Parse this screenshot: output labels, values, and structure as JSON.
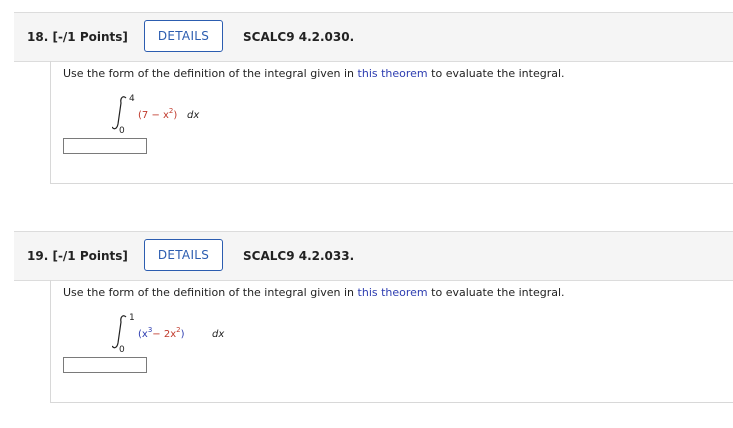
{
  "questions": [
    {
      "number": "18.",
      "points": "[-/1 Points]",
      "details_label": "DETAILS",
      "code": "SCALC9 4.2.030.",
      "prompt_before": "Use the form of the definition of the integral given in ",
      "prompt_link": "this theorem",
      "prompt_after": " to evaluate the integral.",
      "integral": {
        "upper": "4",
        "lower": "0",
        "open": "(7 − x",
        "exp": "2",
        "close": ")",
        "dx": "dx"
      }
    },
    {
      "number": "19.",
      "points": "[-/1 Points]",
      "details_label": "DETAILS",
      "code": "SCALC9 4.2.033.",
      "prompt_before": "Use the form of the definition of the integral given in ",
      "prompt_link": "this theorem",
      "prompt_after": " to evaluate the integral.",
      "integral": {
        "upper": "1",
        "lower": "0",
        "open": "(x",
        "exp1": "3",
        "mid": "− 2x",
        "exp2": "2",
        "close": ")",
        "dx": "dx"
      }
    }
  ],
  "colors": {
    "link": "#2c3cb0",
    "details_button": "#2c5db0",
    "header_bg": "#f5f5f5",
    "red_term": "#c0392b"
  }
}
